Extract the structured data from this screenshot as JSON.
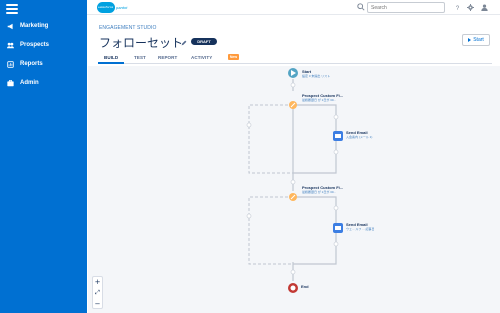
{
  "sidebar": {
    "items": [
      {
        "label": "Marketing",
        "icon": "marketing-icon"
      },
      {
        "label": "Prospects",
        "icon": "prospects-icon"
      },
      {
        "label": "Reports",
        "icon": "reports-icon"
      },
      {
        "label": "Admin",
        "icon": "admin-icon"
      }
    ]
  },
  "topbar": {
    "brand_cloud": "salesforce",
    "brand_product": "pardot",
    "search_placeholder": "Search"
  },
  "header": {
    "studio_label": "ENGAGEMENT STUDIO",
    "title": "フォローセット",
    "status_badge": "DRAFT",
    "start_button": "Start"
  },
  "tabs": [
    {
      "label": "BUILD",
      "active": true
    },
    {
      "label": "TEST",
      "active": false
    },
    {
      "label": "REPORT",
      "active": false
    },
    {
      "label": "ACTIVITY",
      "active": false,
      "badge": "New"
    }
  ],
  "flow": {
    "start": {
      "label": "Start",
      "sub": "設定 0 未提出 リスト"
    },
    "trigger1": {
      "label": "Prospect Custom Fi...",
      "sub": "最終履歴日 が 1日が 30..."
    },
    "email1": {
      "label": "Send Email",
      "sub": "入会案内 (メール 1)"
    },
    "trigger2": {
      "label": "Prospect Custom Fi...",
      "sub": "最終履歴日 が 1日が 30..."
    },
    "email2": {
      "label": "Send Email",
      "sub": "ウェ... ルフ ... 記事日"
    },
    "end": {
      "label": "End"
    }
  },
  "zoom": {
    "zoom_in": "+",
    "fit": "⤢",
    "zoom_out": "−"
  },
  "colors": {
    "sidebar_bg": "#0070d2",
    "accent": "#0070d2",
    "start_node": "#54a4c4",
    "trigger_node": "#ffb75d",
    "email_node": "#3c7ee3",
    "end_node": "#c23934",
    "new_badge": "#ff9a3c"
  }
}
